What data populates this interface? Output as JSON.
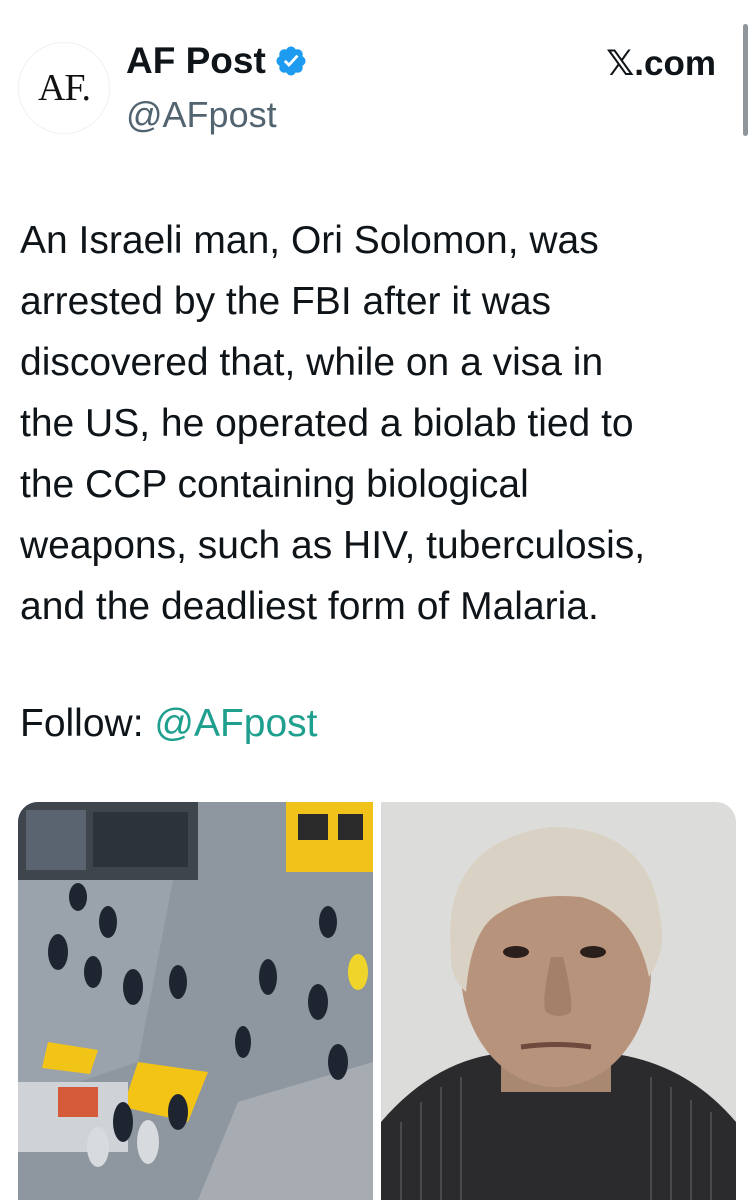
{
  "post": {
    "avatar_text": "AF.",
    "display_name": "AF Post",
    "handle": "@AFpost",
    "source": "𝕏.com",
    "text": "An Israeli man, Ori Solomon, was\narrested by the FBI after it was\ndiscovered that, while on a visa in\nthe US, he operated a biolab tied to\nthe CCP containing biological\nweapons, such as HIV, tuberculosis,\nand the deadliest form of Malaria.",
    "follow_label": "Follow: ",
    "follow_link": "@AFpost"
  },
  "colors": {
    "verified": "#1d9bf0",
    "link": "#1f9f8e",
    "handle": "#536471"
  },
  "icons": {
    "verified": "verified-badge-icon"
  },
  "media": [
    {
      "name": "aerial-photo",
      "kind": "photo"
    },
    {
      "name": "mugshot-photo",
      "kind": "photo"
    }
  ]
}
